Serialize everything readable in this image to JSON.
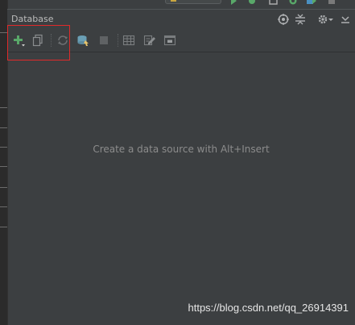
{
  "panel": {
    "title": "Database",
    "empty_message": "Create a data source with Alt+Insert"
  },
  "toolbar": {
    "items": [
      {
        "name": "add-data-source",
        "icon": "plus-icon",
        "color": "#59a869"
      },
      {
        "name": "duplicate",
        "icon": "copy-icon"
      },
      {
        "name": "refresh",
        "icon": "refresh-icon"
      },
      {
        "name": "db-console",
        "icon": "console-icon",
        "color": "#6a9fb5"
      },
      {
        "name": "stop",
        "icon": "stop-icon"
      },
      {
        "name": "table-view",
        "icon": "table-icon"
      },
      {
        "name": "edit-source",
        "icon": "edit-icon"
      },
      {
        "name": "sql-console",
        "icon": "sql-icon"
      }
    ]
  },
  "header_actions": [
    "target-icon",
    "collapse-icon",
    "gear-icon",
    "hide-icon"
  ],
  "top_toolbar": {
    "run_config_label": "",
    "icons": [
      "run-icon",
      "debug-icon",
      "coverage-icon",
      "profile-icon",
      "deploy-icon"
    ]
  },
  "watermark": "https://blog.csdn.net/qq_26914391",
  "colors": {
    "background": "#3c3f41",
    "text": "#bbbbbb",
    "hint": "#8c8c8c",
    "highlight": "#e02a2a",
    "accent_green": "#59a869"
  }
}
